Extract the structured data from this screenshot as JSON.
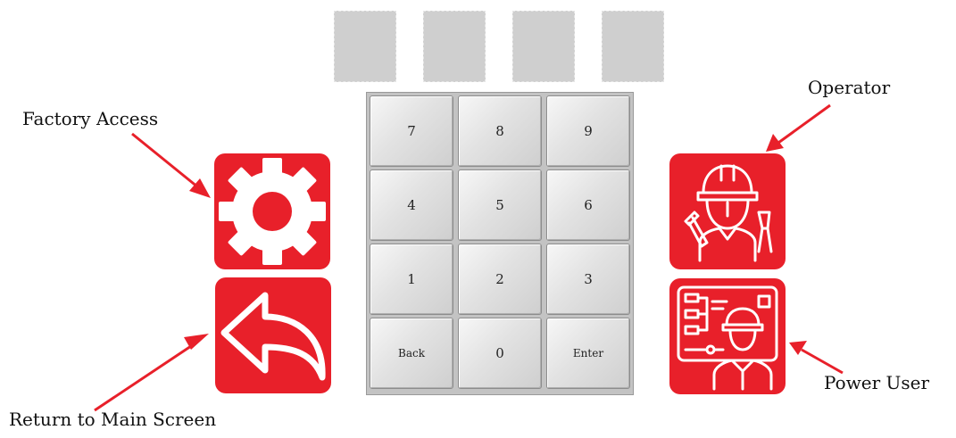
{
  "pin_slots": 4,
  "keypad": {
    "keys": [
      "7",
      "8",
      "9",
      "4",
      "5",
      "6",
      "1",
      "2",
      "3",
      "Back",
      "0",
      "Enter"
    ]
  },
  "labels": {
    "factory_access": "Factory Access",
    "return_main": "Return to Main Screen",
    "operator": "Operator",
    "power_user": "Power User"
  },
  "icons": {
    "factory_access": "gear-icon",
    "return_main": "back-arrow-icon",
    "operator": "worker-helmet-icon",
    "power_user": "engineer-panel-icon"
  },
  "colors": {
    "tile": "#e8202a",
    "annotation_arrow": "#e8202a"
  }
}
